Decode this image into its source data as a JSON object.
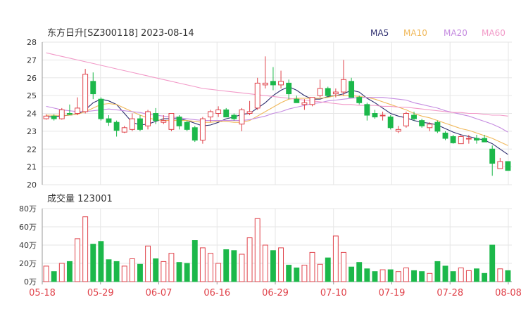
{
  "header": {
    "title": "东方日升[SZ300118] 2023-08-14",
    "legend": [
      {
        "label": "MA5",
        "color": "#2d2d6e"
      },
      {
        "label": "MA10",
        "color": "#f0b85a"
      },
      {
        "label": "MA20",
        "color": "#c58be0"
      },
      {
        "label": "MA60",
        "color": "#f29ac8"
      }
    ]
  },
  "volume_title": "成交量 123001",
  "colors": {
    "up": "#e0424a",
    "down": "#1cb84a",
    "grid": "#e6e6e6",
    "axis": "#333333",
    "date": "#e0424a"
  },
  "chart_data": [
    {
      "type": "candlestick",
      "title": "东方日升[SZ300118] 2023-08-14",
      "ylim": [
        20,
        28
      ],
      "y_ticks": [
        "28",
        "27",
        "26",
        "25",
        "24",
        "23",
        "22",
        "21",
        "20"
      ],
      "x_ticks": [
        "05-18",
        "05-29",
        "06-07",
        "06-16",
        "06-29",
        "07-10",
        "07-19",
        "07-28",
        "08-08"
      ],
      "ohlc": [
        [
          23.7,
          23.95,
          23.65,
          23.85
        ],
        [
          23.85,
          23.95,
          23.6,
          23.7
        ],
        [
          23.7,
          24.3,
          23.65,
          24.2
        ],
        [
          24.0,
          24.5,
          23.9,
          23.95
        ],
        [
          24.0,
          24.9,
          23.9,
          24.3
        ],
        [
          24.1,
          26.5,
          24.0,
          26.2
        ],
        [
          25.8,
          26.3,
          24.8,
          25.1
        ],
        [
          24.8,
          24.9,
          23.6,
          23.7
        ],
        [
          23.7,
          23.9,
          23.3,
          23.5
        ],
        [
          23.5,
          23.6,
          22.7,
          23.05
        ],
        [
          22.95,
          23.3,
          22.9,
          23.2
        ],
        [
          23.1,
          24.0,
          23.0,
          23.7
        ],
        [
          23.7,
          23.9,
          23.0,
          23.1
        ],
        [
          23.3,
          24.2,
          23.1,
          24.1
        ],
        [
          24.0,
          24.3,
          23.4,
          23.6
        ],
        [
          23.5,
          23.9,
          23.4,
          23.6
        ],
        [
          23.1,
          24.0,
          23.0,
          24.0
        ],
        [
          23.8,
          23.9,
          23.1,
          23.3
        ],
        [
          23.5,
          23.6,
          23.0,
          23.1
        ],
        [
          23.2,
          23.3,
          22.4,
          22.5
        ],
        [
          22.5,
          23.8,
          22.3,
          23.7
        ],
        [
          23.8,
          24.2,
          23.5,
          24.1
        ],
        [
          24.0,
          24.4,
          23.8,
          24.2
        ],
        [
          24.2,
          24.3,
          23.8,
          23.8
        ],
        [
          23.9,
          24.0,
          23.6,
          23.7
        ],
        [
          23.4,
          24.3,
          23.0,
          24.2
        ],
        [
          24.0,
          24.7,
          23.9,
          24.1
        ],
        [
          24.3,
          26.0,
          24.2,
          25.7
        ],
        [
          25.6,
          27.2,
          25.4,
          25.7
        ],
        [
          25.8,
          26.6,
          25.3,
          25.6
        ],
        [
          25.6,
          26.4,
          25.4,
          25.8
        ],
        [
          25.7,
          25.9,
          24.8,
          25.1
        ],
        [
          24.8,
          25.0,
          24.6,
          24.6
        ],
        [
          24.5,
          24.8,
          24.2,
          24.6
        ],
        [
          24.5,
          24.9,
          24.4,
          24.9
        ],
        [
          25.0,
          25.9,
          24.9,
          25.4
        ],
        [
          25.4,
          25.5,
          24.9,
          25.0
        ],
        [
          25.1,
          25.4,
          24.9,
          25.2
        ],
        [
          25.2,
          27.0,
          25.0,
          25.9
        ],
        [
          25.8,
          26.0,
          24.9,
          24.9
        ],
        [
          24.9,
          25.0,
          24.5,
          24.6
        ],
        [
          24.5,
          24.6,
          23.6,
          23.9
        ],
        [
          24.0,
          24.2,
          23.7,
          23.8
        ],
        [
          23.9,
          24.1,
          23.6,
          23.9
        ],
        [
          23.8,
          23.9,
          23.1,
          23.2
        ],
        [
          23.0,
          23.3,
          22.9,
          23.1
        ],
        [
          23.3,
          24.1,
          23.2,
          24.0
        ],
        [
          23.9,
          24.1,
          23.6,
          23.7
        ],
        [
          23.6,
          23.7,
          23.2,
          23.3
        ],
        [
          23.2,
          23.5,
          23.0,
          23.4
        ],
        [
          23.5,
          23.6,
          22.9,
          23.0
        ],
        [
          22.9,
          23.0,
          22.5,
          22.6
        ],
        [
          22.7,
          22.8,
          22.3,
          22.35
        ],
        [
          22.3,
          22.8,
          22.3,
          22.7
        ],
        [
          22.6,
          22.8,
          22.3,
          22.6
        ],
        [
          22.6,
          22.8,
          22.3,
          22.5
        ],
        [
          22.6,
          22.8,
          22.4,
          22.4
        ],
        [
          22.0,
          22.2,
          20.5,
          21.2
        ],
        [
          20.9,
          21.5,
          20.9,
          21.3
        ],
        [
          21.3,
          21.3,
          20.8,
          20.8
        ]
      ],
      "ma_series": [
        {
          "name": "MA5",
          "values": [
            23.8,
            23.82,
            23.86,
            23.9,
            23.95,
            24.2,
            24.6,
            24.8,
            24.7,
            24.5,
            24.0,
            23.5,
            23.35,
            23.4,
            23.55,
            23.7,
            23.7,
            23.7,
            23.6,
            23.45,
            23.3,
            23.35,
            23.5,
            23.7,
            23.8,
            23.95,
            24.0,
            24.3,
            24.6,
            25.0,
            25.3,
            25.5,
            25.3,
            25.0,
            24.8,
            24.8,
            24.95,
            25.0,
            25.1,
            25.3,
            25.2,
            24.85,
            24.6,
            24.3,
            24.0,
            23.85,
            23.75,
            23.6,
            23.5,
            23.45,
            23.35,
            23.15,
            22.95,
            22.8,
            22.7,
            22.6,
            22.5,
            22.3,
            22.0,
            21.7
          ]
        },
        {
          "name": "MA10",
          "values": [
            23.9,
            23.9,
            23.88,
            23.9,
            23.95,
            24.1,
            24.3,
            24.5,
            24.55,
            24.5,
            24.3,
            24.1,
            23.9,
            23.75,
            23.65,
            23.6,
            23.6,
            23.6,
            23.6,
            23.55,
            23.5,
            23.5,
            23.55,
            23.55,
            23.5,
            23.5,
            23.6,
            23.85,
            24.1,
            24.35,
            24.6,
            24.8,
            24.85,
            24.85,
            24.85,
            24.85,
            24.9,
            25.0,
            25.0,
            25.0,
            24.95,
            24.9,
            24.8,
            24.65,
            24.5,
            24.35,
            24.2,
            24.0,
            23.85,
            23.75,
            23.6,
            23.45,
            23.3,
            23.15,
            23.05,
            22.9,
            22.75,
            22.6,
            22.4,
            22.2
          ]
        },
        {
          "name": "MA20",
          "values": [
            24.4,
            24.3,
            24.2,
            24.15,
            24.1,
            24.1,
            24.15,
            24.2,
            24.25,
            24.2,
            24.15,
            24.1,
            24.05,
            23.95,
            23.9,
            23.85,
            23.8,
            23.75,
            23.7,
            23.65,
            23.6,
            23.6,
            23.6,
            23.6,
            23.6,
            23.6,
            23.65,
            23.75,
            23.85,
            24.0,
            24.1,
            24.25,
            24.35,
            24.45,
            24.55,
            24.6,
            24.7,
            24.75,
            24.8,
            24.85,
            24.9,
            24.9,
            24.9,
            24.9,
            24.85,
            24.8,
            24.75,
            24.6,
            24.5,
            24.4,
            24.3,
            24.15,
            24.05,
            23.95,
            23.85,
            23.7,
            23.55,
            23.4,
            23.2,
            22.95
          ]
        },
        {
          "name": "MA60",
          "values": [
            27.4,
            27.3,
            27.2,
            27.1,
            27.0,
            26.9,
            26.8,
            26.7,
            26.6,
            26.5,
            26.4,
            26.3,
            26.2,
            26.1,
            26.0,
            25.9,
            25.8,
            25.7,
            25.6,
            25.5,
            25.4,
            25.35,
            25.3,
            25.25,
            25.2,
            25.15,
            25.1,
            25.05,
            25.0,
            24.95,
            24.9,
            24.85,
            24.8,
            24.75,
            24.7,
            24.65,
            24.6,
            24.55,
            24.5,
            24.5,
            24.45,
            24.45,
            24.45,
            24.4,
            24.4,
            24.35,
            24.35,
            24.3,
            24.25,
            24.2,
            24.15,
            24.1,
            24.05,
            24.05,
            24.0,
            24.0,
            23.95,
            23.9,
            23.9,
            23.85
          ]
        }
      ]
    },
    {
      "type": "bar",
      "title": "成交量 123001",
      "ylim": [
        0,
        80
      ],
      "y_ticks": [
        "80万",
        "60万",
        "40万",
        "20万",
        "0万"
      ],
      "values": [
        17,
        11,
        20,
        22,
        47,
        71,
        41,
        44,
        24,
        22,
        17,
        25,
        19,
        39,
        25,
        22,
        31,
        21,
        20,
        45,
        37,
        31,
        20,
        35,
        34,
        30,
        48,
        69,
        40,
        34,
        37,
        18,
        15,
        18,
        32,
        19,
        26,
        50,
        32,
        16,
        21,
        14,
        11,
        13,
        13,
        11,
        15,
        12,
        11,
        9,
        22,
        17,
        11,
        15,
        12,
        14,
        9,
        40,
        14,
        12
      ]
    }
  ]
}
